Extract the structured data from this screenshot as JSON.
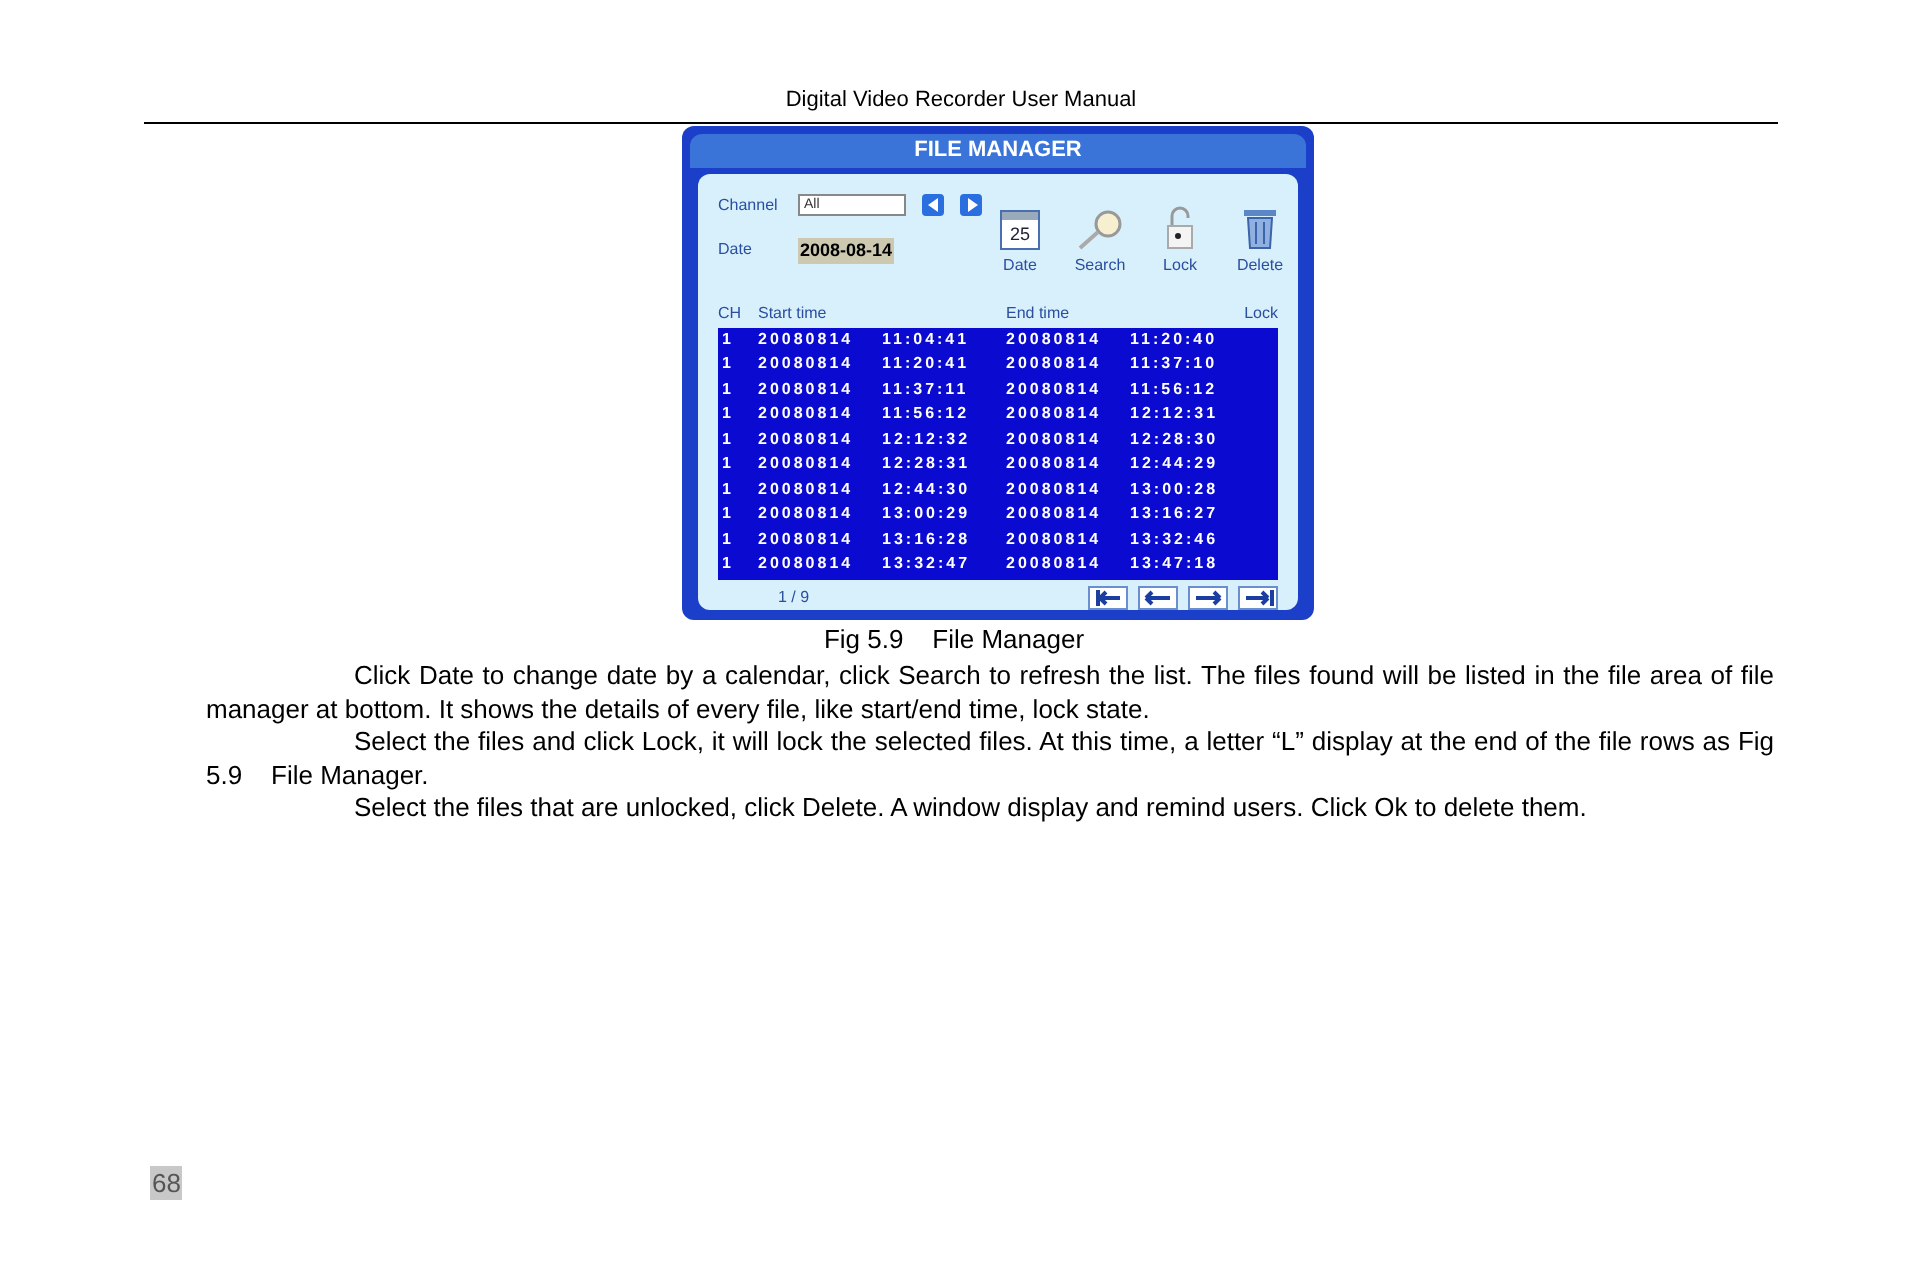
{
  "header": "Digital Video Recorder User Manual",
  "figure": {
    "title": "FILE MANAGER",
    "channel_label": "Channel",
    "channel_value": "All",
    "date_label": "Date",
    "date_value": "2008-08-14",
    "tools": [
      {
        "kind": "calendar",
        "label": "Date",
        "day": "25"
      },
      {
        "kind": "search",
        "label": "Search"
      },
      {
        "kind": "lock",
        "label": "Lock"
      },
      {
        "kind": "delete",
        "label": "Delete"
      }
    ],
    "columns": [
      "CH",
      "Start time",
      "End time",
      "Lock"
    ],
    "rows": [
      {
        "ch": "1",
        "start_date": "20080814",
        "start_time": "11:04:41",
        "end_date": "20080814",
        "end_time": "11:20:40"
      },
      {
        "ch": "1",
        "start_date": "20080814",
        "start_time": "11:20:41",
        "end_date": "20080814",
        "end_time": "11:37:10"
      },
      {
        "ch": "1",
        "start_date": "20080814",
        "start_time": "11:37:11",
        "end_date": "20080814",
        "end_time": "11:56:12"
      },
      {
        "ch": "1",
        "start_date": "20080814",
        "start_time": "11:56:12",
        "end_date": "20080814",
        "end_time": "12:12:31"
      },
      {
        "ch": "1",
        "start_date": "20080814",
        "start_time": "12:12:32",
        "end_date": "20080814",
        "end_time": "12:28:30"
      },
      {
        "ch": "1",
        "start_date": "20080814",
        "start_time": "12:28:31",
        "end_date": "20080814",
        "end_time": "12:44:29"
      },
      {
        "ch": "1",
        "start_date": "20080814",
        "start_time": "12:44:30",
        "end_date": "20080814",
        "end_time": "13:00:28"
      },
      {
        "ch": "1",
        "start_date": "20080814",
        "start_time": "13:00:29",
        "end_date": "20080814",
        "end_time": "13:16:27"
      },
      {
        "ch": "1",
        "start_date": "20080814",
        "start_time": "13:16:28",
        "end_date": "20080814",
        "end_time": "13:32:46"
      },
      {
        "ch": "1",
        "start_date": "20080814",
        "start_time": "13:32:47",
        "end_date": "20080814",
        "end_time": "13:47:18"
      }
    ],
    "page": "1 / 9"
  },
  "caption": "Fig 5.9    File Manager",
  "paragraphs": [
    "Click Date to change date by a calendar, click Search to refresh the list. The files found will be listed in the file area of file manager at bottom. It shows the details of every file, like start/end time, lock state.",
    "Select the files and click Lock, it will lock the selected files. At this time, a letter “L” display at the end of the file rows as Fig 5.9    File Manager.",
    "Select the files that are unlocked, click Delete. A window display and remind users. Click Ok to delete them."
  ],
  "page_number": "68"
}
